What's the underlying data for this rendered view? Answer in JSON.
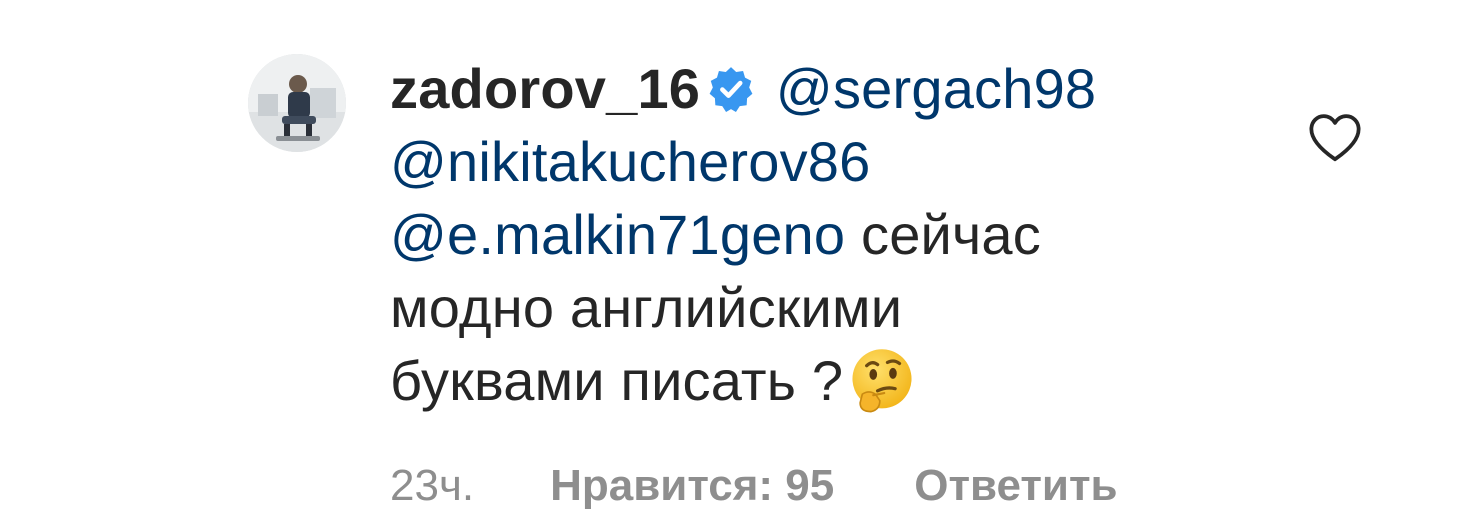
{
  "comment": {
    "username": "zadorov_16",
    "verified": true,
    "mentions": [
      "@sergach98",
      "@nikitakucherov86",
      "@e.malkin71geno"
    ],
    "text_line1": "сейчас",
    "text_line2": "модно английскими",
    "text_line3": "буквами писать ?",
    "emoji": "thinking-face-emoji",
    "time": "23ч.",
    "likes_label": "Нравится: 95",
    "reply_label": "Ответить"
  },
  "icons": {
    "verified": "verified-badge-icon",
    "like": "heart-outline-icon"
  },
  "colors": {
    "text": "#262626",
    "mention": "#00376b",
    "meta": "#8e8e8e",
    "verified_badge": "#3897f0",
    "emoji_face": "#f7c23a"
  }
}
